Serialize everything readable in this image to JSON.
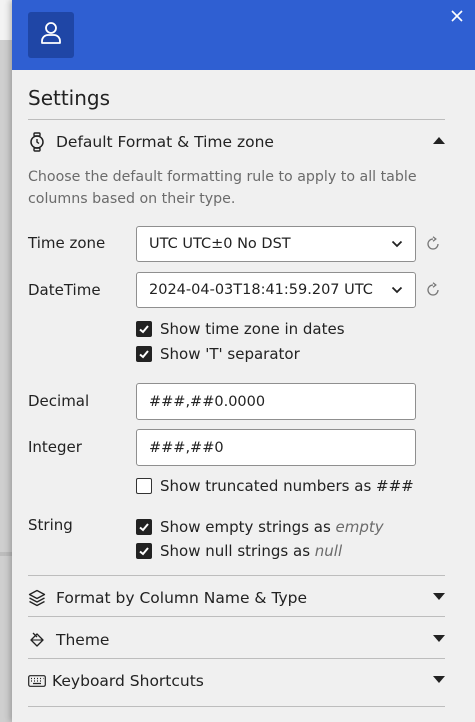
{
  "header": {
    "user_icon": "user-icon",
    "close_icon": "close-icon"
  },
  "settings": {
    "title": "Settings",
    "default_format": {
      "label": "Default Format & Time zone",
      "icon": "watch-icon",
      "expanded": true,
      "description": "Choose the default formatting rule to apply to all table columns based on their type.",
      "time_zone": {
        "label": "Time zone",
        "value": "UTC UTC±0 No DST"
      },
      "datetime": {
        "label": "DateTime",
        "value": "2024-04-03T18:41:59.207 UTC",
        "options": [
          {
            "label": "Show time zone in dates",
            "checked": true
          },
          {
            "label": "Show 'T' separator",
            "checked": true
          }
        ]
      },
      "decimal": {
        "label": "Decimal",
        "value": "###,##0.0000"
      },
      "integer": {
        "label": "Integer",
        "value": "###,##0",
        "options": [
          {
            "label": "Show truncated numbers as ###",
            "checked": false
          }
        ]
      },
      "string": {
        "label": "String",
        "options": [
          {
            "prefix": "Show empty strings as ",
            "em": "empty",
            "checked": true
          },
          {
            "prefix": "Show null strings as ",
            "em": "null",
            "checked": true
          }
        ]
      }
    },
    "sections": [
      {
        "label": "Format by Column Name & Type",
        "icon": "layers-icon",
        "expanded": false
      },
      {
        "label": "Theme",
        "icon": "paint-bucket-icon",
        "expanded": false
      },
      {
        "label": "Keyboard Shortcuts",
        "icon": "keyboard-icon",
        "expanded": false
      }
    ]
  }
}
